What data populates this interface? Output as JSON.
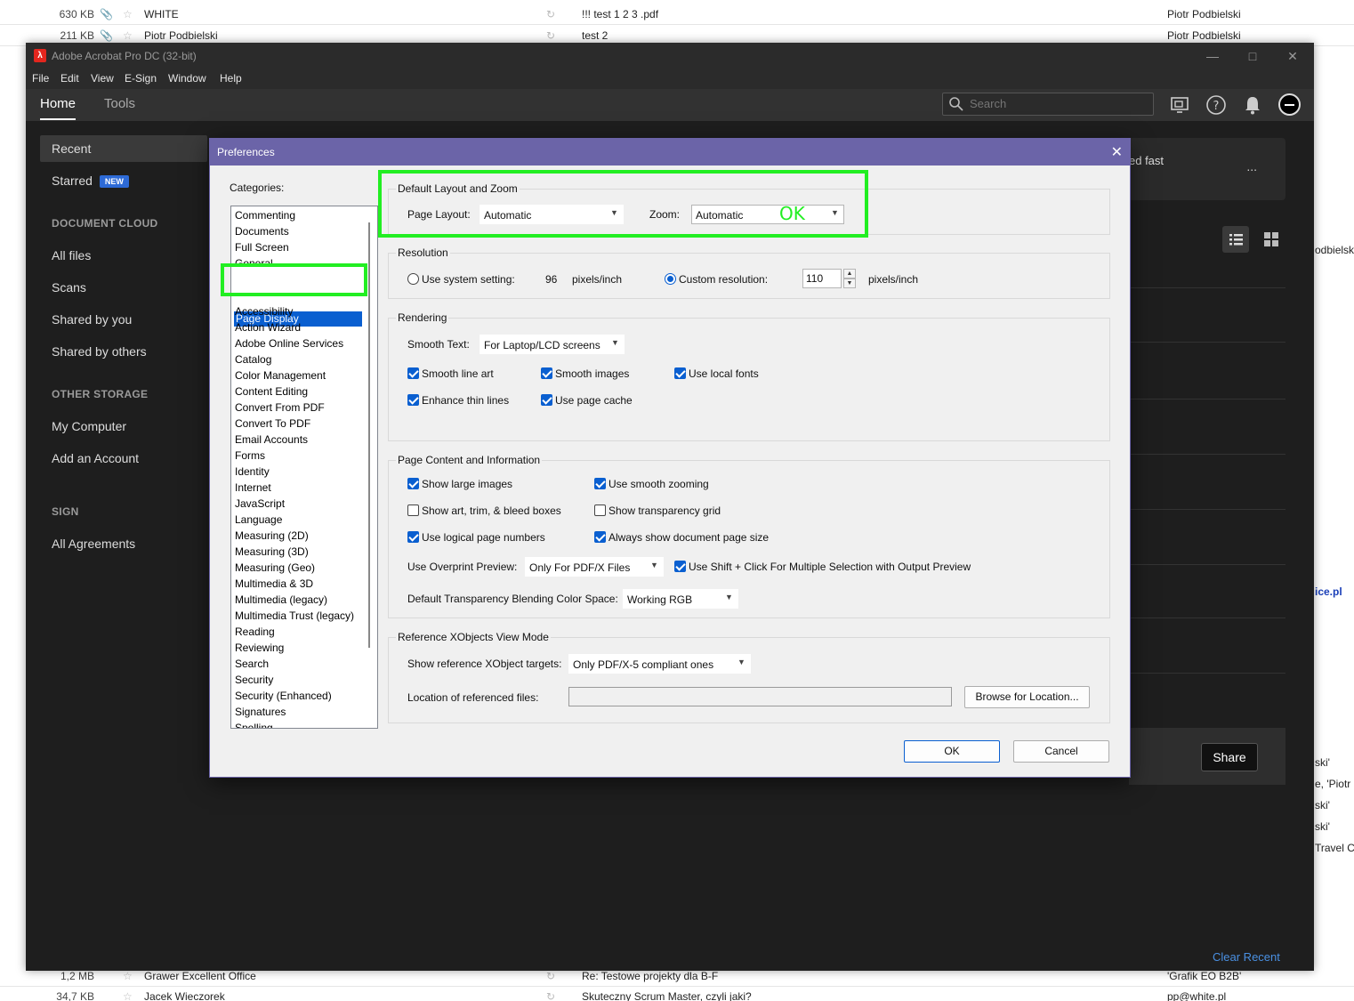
{
  "mail_rows_top": [
    {
      "size": "630 KB",
      "from": "WHITE",
      "subject": "!!! test 1 2 3 .pdf",
      "to": "Piotr Podbielski"
    },
    {
      "size": "211 KB",
      "from": "Piotr Podbielski",
      "subject": "test 2",
      "to": "Piotr Podbielski"
    }
  ],
  "mail_rows_bottom": [
    {
      "size": "1,2 MB",
      "from": "Grawer Excellent Office",
      "subject": "Re: Testowe projekty dla B-F",
      "to": "'Grafik EO B2B'"
    },
    {
      "size": "34,7 KB",
      "from": "Jacek Wieczorek",
      "subject": "Skuteczny Scrum Master, czyli jaki?",
      "to": "pp@white.pl"
    }
  ],
  "bg_right_text": [
    "odbielski",
    "ice.pl",
    "ski'",
    "e, 'Piotr P",
    "ski'",
    "ski'",
    "Travel C"
  ],
  "acrobat": {
    "title": "Adobe Acrobat Pro DC (32-bit)",
    "menu": [
      "File",
      "Edit",
      "View",
      "E-Sign",
      "Window",
      "Help"
    ],
    "tabs": {
      "home": "Home",
      "tools": "Tools"
    },
    "search_placeholder": "Search",
    "sidebar": {
      "recent": "Recent",
      "starred": "Starred",
      "new_badge": "NEW",
      "document_cloud": "DOCUMENT CLOUD",
      "all_files": "All files",
      "scans": "Scans",
      "shared_by_you": "Shared by you",
      "shared_by_others": "Shared by others",
      "other_storage": "OTHER STORAGE",
      "my_computer": "My Computer",
      "add_account": "Add an Account",
      "sign": "SIGN",
      "all_agreements": "All Agreements"
    },
    "card_text": "ed fast",
    "card_dots": "...",
    "share": "Share",
    "clear_recent": "Clear Recent"
  },
  "dialog": {
    "title": "Preferences",
    "categories_label": "Categories:",
    "categories_top": [
      "Commenting",
      "Documents",
      "Full Screen",
      "General"
    ],
    "selected_category": "Page Display",
    "categories": [
      "Accessibility",
      "Action Wizard",
      "Adobe Online Services",
      "Catalog",
      "Color Management",
      "Content Editing",
      "Convert From PDF",
      "Convert To PDF",
      "Email Accounts",
      "Forms",
      "Identity",
      "Internet",
      "JavaScript",
      "Language",
      "Measuring (2D)",
      "Measuring (3D)",
      "Measuring (Geo)",
      "Multimedia & 3D",
      "Multimedia (legacy)",
      "Multimedia Trust (legacy)",
      "Reading",
      "Reviewing",
      "Search",
      "Security",
      "Security (Enhanced)",
      "Signatures",
      "Spelling"
    ],
    "layout_zoom": {
      "title": "Default Layout and Zoom",
      "page_layout_label": "Page Layout:",
      "page_layout_value": "Automatic",
      "zoom_label": "Zoom:",
      "zoom_value": "Automatic",
      "annotation": "OK"
    },
    "resolution": {
      "title": "Resolution",
      "use_system": "Use system setting:",
      "system_value": "96",
      "unit": "pixels/inch",
      "custom": "Custom resolution:",
      "custom_value": "110",
      "selected": "custom"
    },
    "rendering": {
      "title": "Rendering",
      "smooth_text_label": "Smooth Text:",
      "smooth_text_value": "For Laptop/LCD screens",
      "smooth_line_art": "Smooth line art",
      "smooth_images": "Smooth images",
      "use_local_fonts": "Use local fonts",
      "enhance_thin_lines": "Enhance thin lines",
      "use_page_cache": "Use page cache"
    },
    "page_content": {
      "title": "Page Content and Information",
      "show_large_images": "Show large images",
      "use_smooth_zooming": "Use smooth zooming",
      "show_art_trim": "Show art, trim, & bleed boxes",
      "show_transparency_grid": "Show transparency grid",
      "use_logical_page_numbers": "Use logical page numbers",
      "always_show_page_size": "Always show document page size",
      "overprint_label": "Use Overprint Preview:",
      "overprint_value": "Only For PDF/X Files",
      "use_shift_click": "Use Shift + Click For Multiple Selection with Output Preview",
      "blending_label": "Default Transparency Blending Color Space:",
      "blending_value": "Working RGB"
    },
    "xobjects": {
      "title": "Reference XObjects View Mode",
      "targets_label": "Show reference XObject targets:",
      "targets_value": "Only PDF/X-5 compliant ones",
      "location_label": "Location of referenced files:",
      "location_value": "",
      "browse": "Browse for Location..."
    },
    "ok": "OK",
    "cancel": "Cancel"
  }
}
